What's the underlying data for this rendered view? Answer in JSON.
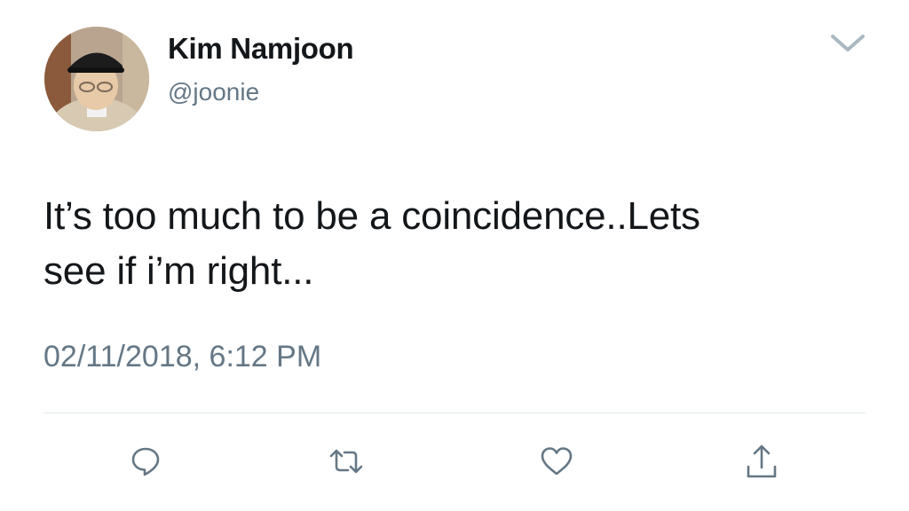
{
  "user": {
    "display_name": "Kim Namjoon",
    "handle": "@joonie"
  },
  "tweet": {
    "text": "It’s too much to be a coincidence..Lets\nsee if i’m right...",
    "timestamp": "02/11/2018, 6:12 PM"
  },
  "actions": [
    {
      "name": "reply",
      "icon": "speech-bubble-icon"
    },
    {
      "name": "retweet",
      "icon": "retweet-arrows-icon"
    },
    {
      "name": "like",
      "icon": "heart-icon"
    },
    {
      "name": "share",
      "icon": "share-upload-icon"
    }
  ],
  "colors": {
    "text_primary": "#14171a",
    "text_secondary": "#657786",
    "icon": "#657786",
    "divider": "#e1e8ed",
    "caret": "#aab8c2"
  }
}
